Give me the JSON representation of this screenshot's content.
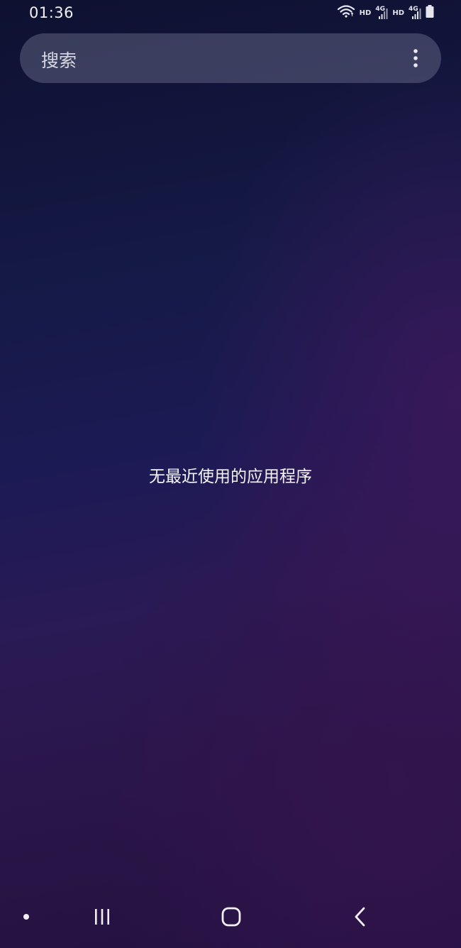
{
  "status_bar": {
    "time": "01:36",
    "hd_label_1": "HD",
    "hd_label_2": "HD",
    "network_1": "4G",
    "network_2": "4G",
    "icons": [
      "wifi-icon",
      "signal-icon",
      "signal-icon",
      "battery-icon"
    ]
  },
  "search": {
    "placeholder": "搜索",
    "more_icon": "more-vertical-icon"
  },
  "main": {
    "empty_message": "无最近使用的应用程序"
  },
  "nav_bar": {
    "icons": [
      "dot-indicator",
      "recent-apps-icon",
      "home-icon",
      "back-icon"
    ]
  },
  "colors": {
    "background_top": "#0e1130",
    "background_mid": "#1d1a55",
    "background_bottom": "#231140",
    "search_bar": "#5a5c7a",
    "text": "#ffffff"
  }
}
